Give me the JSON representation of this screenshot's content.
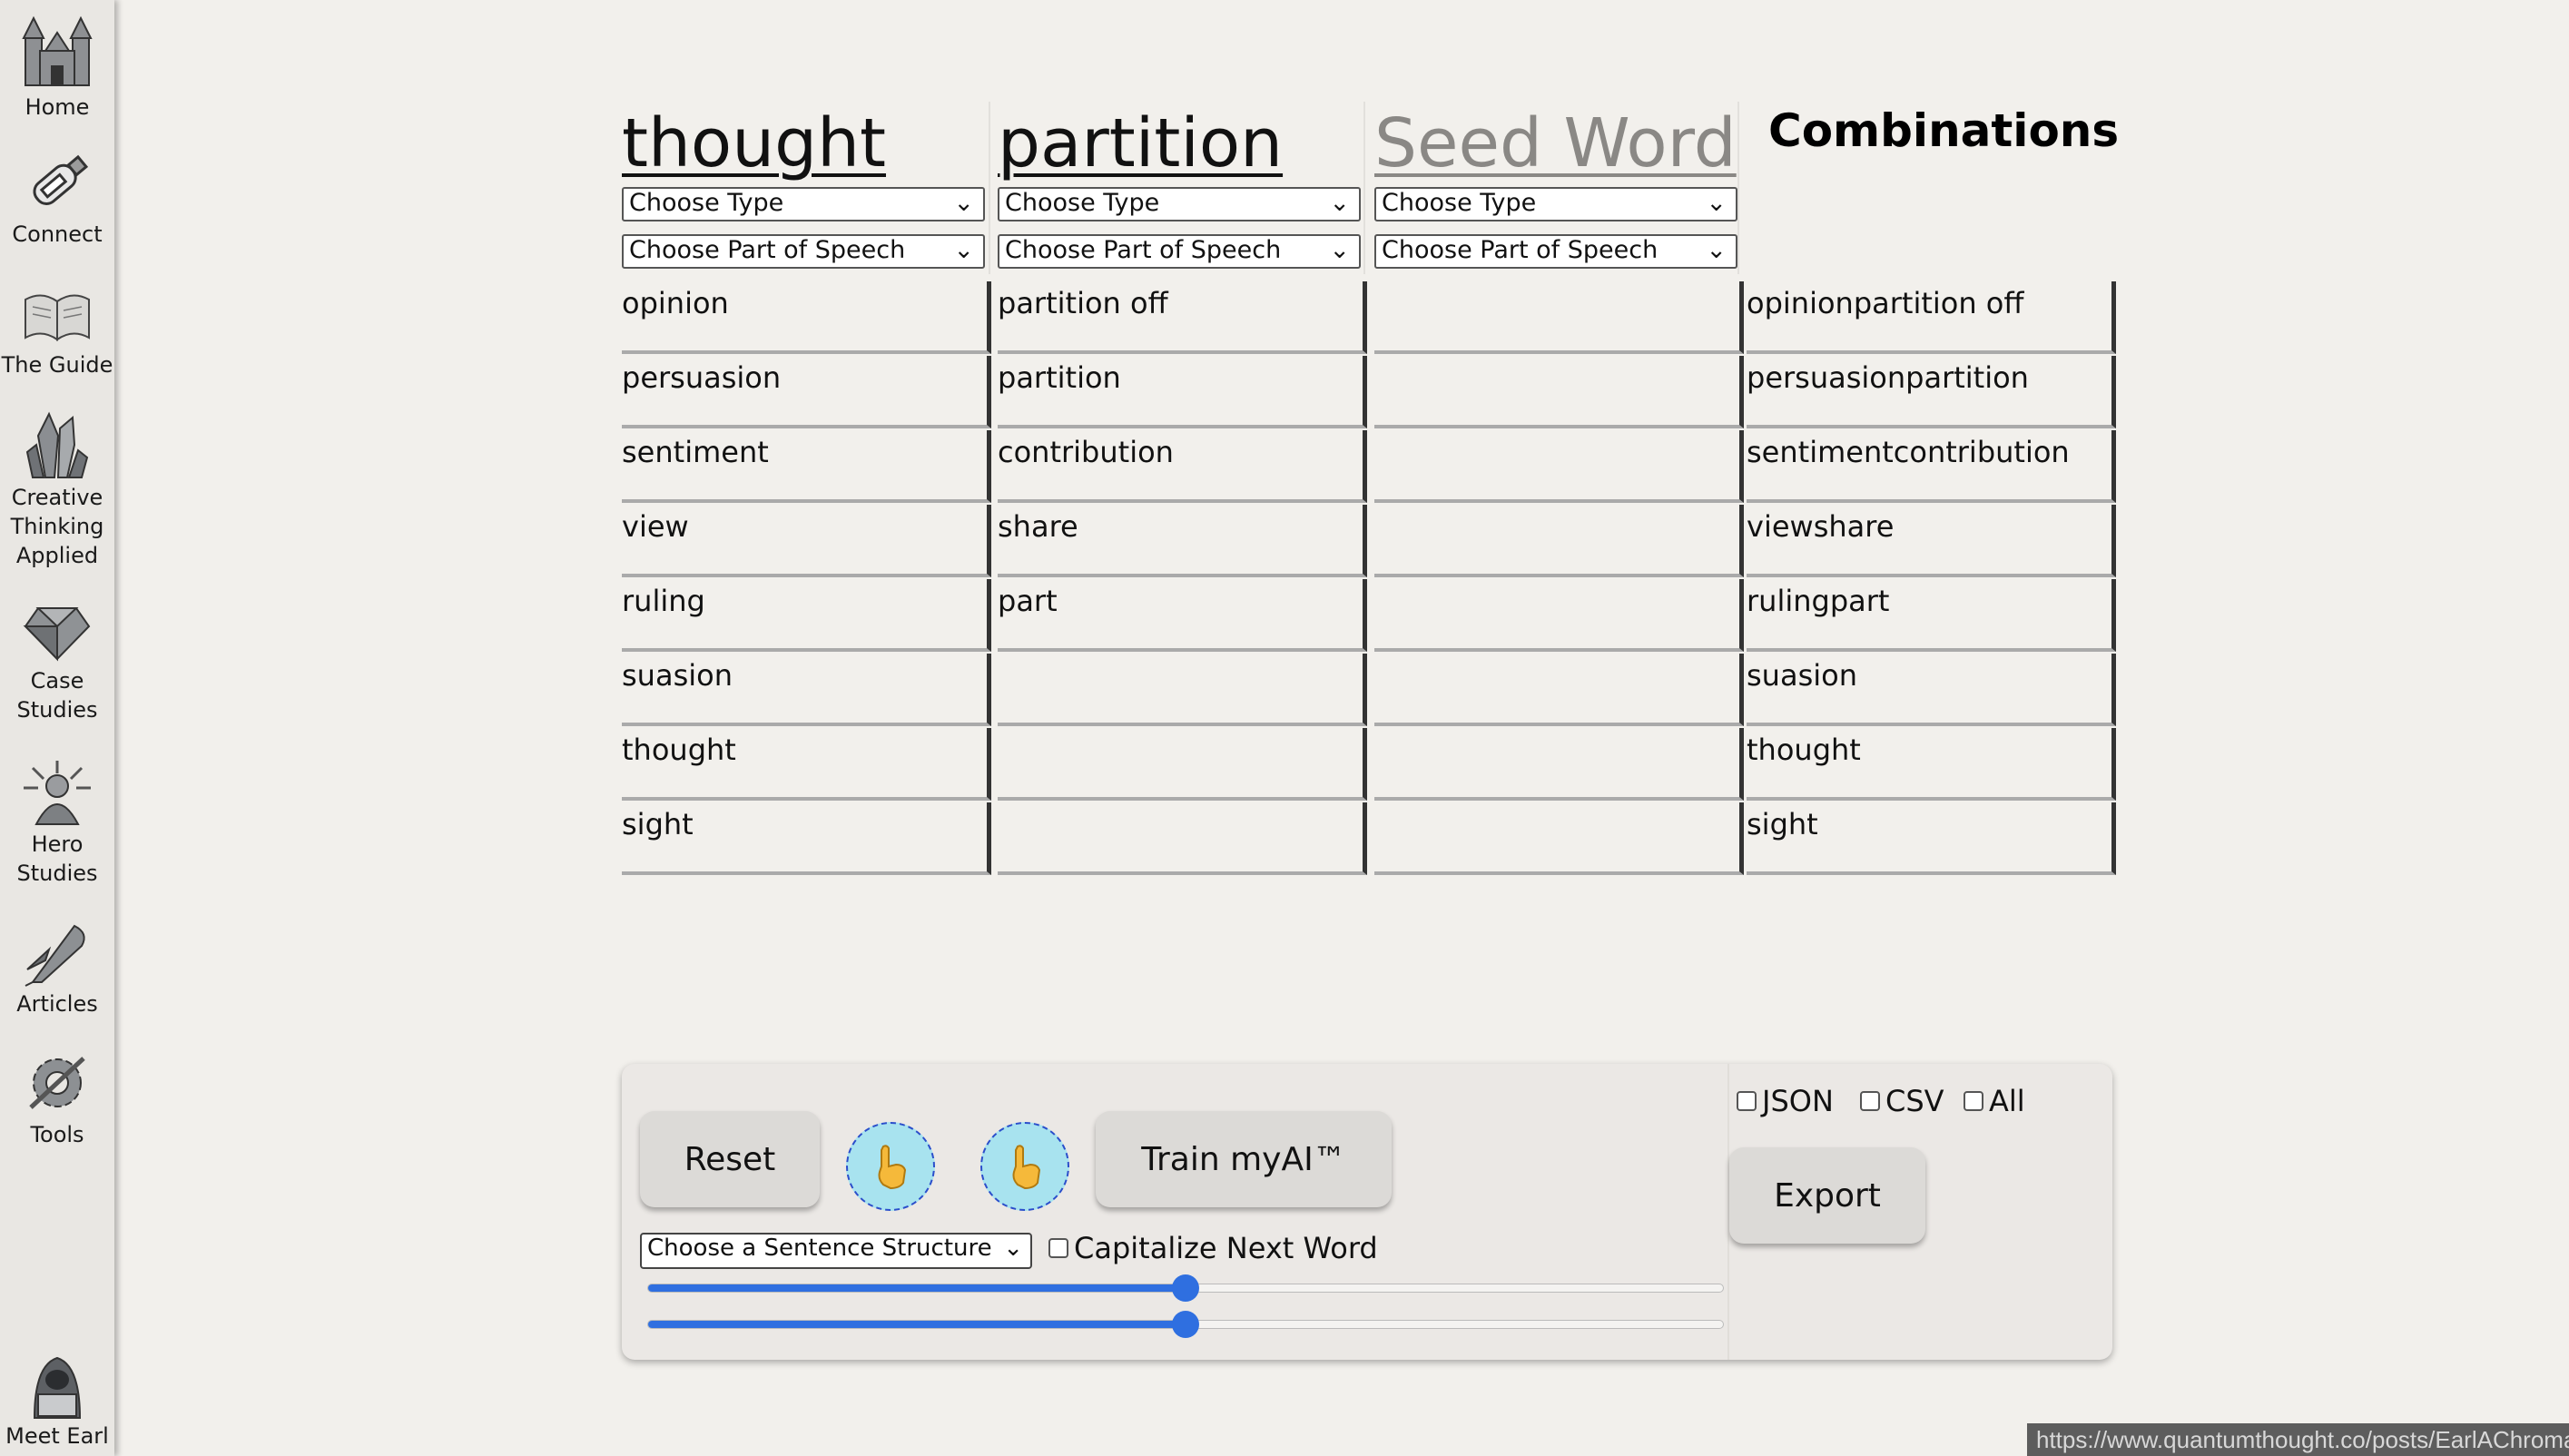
{
  "sidebar": {
    "items": [
      {
        "label": "Home",
        "icon": "castle-icon"
      },
      {
        "label": "Connect",
        "icon": "message-bottle-icon"
      },
      {
        "label": "The Guide",
        "icon": "open-book-icon"
      },
      {
        "label": "Creative Thinking Applied",
        "icon": "crystal-cluster-icon"
      },
      {
        "label": "Case Studies",
        "icon": "gem-stone-icon"
      },
      {
        "label": "Hero Studies",
        "icon": "hero-figure-icon"
      },
      {
        "label": "Articles",
        "icon": "quill-icon"
      },
      {
        "label": "Tools",
        "icon": "gear-tools-icon"
      }
    ],
    "footer": {
      "label": "Meet Earl",
      "icon": "hooded-figure-laptop-icon"
    }
  },
  "columns": [
    {
      "title": "thought",
      "type_select": "Choose Type",
      "pos_select": "Choose Part of Speech",
      "words": [
        "opinion",
        "persuasion",
        "sentiment",
        "view",
        "ruling",
        "suasion",
        "thought",
        "sight"
      ]
    },
    {
      "title": "partition",
      "type_select": "Choose Type",
      "pos_select": "Choose Part of Speech",
      "words": [
        "partition off",
        "partition",
        "contribution",
        "share",
        "part",
        "",
        "",
        ""
      ]
    },
    {
      "title": "Seed Word",
      "type_select": "Choose Type",
      "pos_select": "Choose Part of Speech",
      "words": [
        "",
        "",
        "",
        "",
        "",
        "",
        "",
        ""
      ]
    }
  ],
  "combinations": {
    "title": "Combinations",
    "words": [
      "opinionpartition off",
      "persuasionpartition",
      "sentimentcontribution",
      "viewshare",
      "rulingpart",
      "suasion",
      "thought",
      "sight"
    ]
  },
  "panel": {
    "reset_label": "Reset",
    "train_label": "Train myAI™",
    "export_label": "Export",
    "hand_icon_1": "pointing-hand-icon",
    "hand_icon_2": "pointing-hand-icon",
    "structure_select": "Choose a Sentence Structure",
    "capitalize_label": "Capitalize Next Word",
    "format_options": [
      "JSON",
      "CSV",
      "All"
    ],
    "slider_1_value": 0.5,
    "slider_2_value": 0.5
  },
  "status_url": "https://www.quantumthought.co/posts/EarlAChroma",
  "colors": {
    "accent": "#2f6fe0",
    "hand_bg": "#a8e3ef",
    "background": "#f2f0ec"
  }
}
